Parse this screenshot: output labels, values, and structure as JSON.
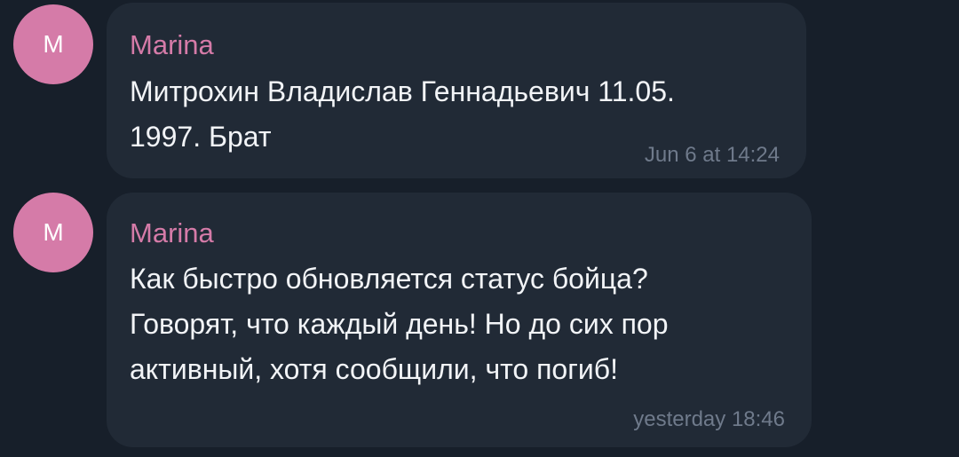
{
  "colors": {
    "background": "#171f2a",
    "bubble": "#212a36",
    "avatar": "#d57ba8",
    "sender_name": "#d57ba8",
    "message_text": "#f2f4f7",
    "timestamp": "#6f7a8b"
  },
  "messages": [
    {
      "avatar_initial": "M",
      "sender": "Marina",
      "text": "Митрохин Владислав Геннадьевич 11.05.\n1997. Брат",
      "time": "Jun 6 at 14:24"
    },
    {
      "avatar_initial": "M",
      "sender": "Marina",
      "text": "Как быстро обновляется статус бойца?\nГоворят, что каждый день! Но до сих пор\nактивный, хотя сообщили, что погиб!",
      "time": "yesterday 18:46"
    }
  ]
}
